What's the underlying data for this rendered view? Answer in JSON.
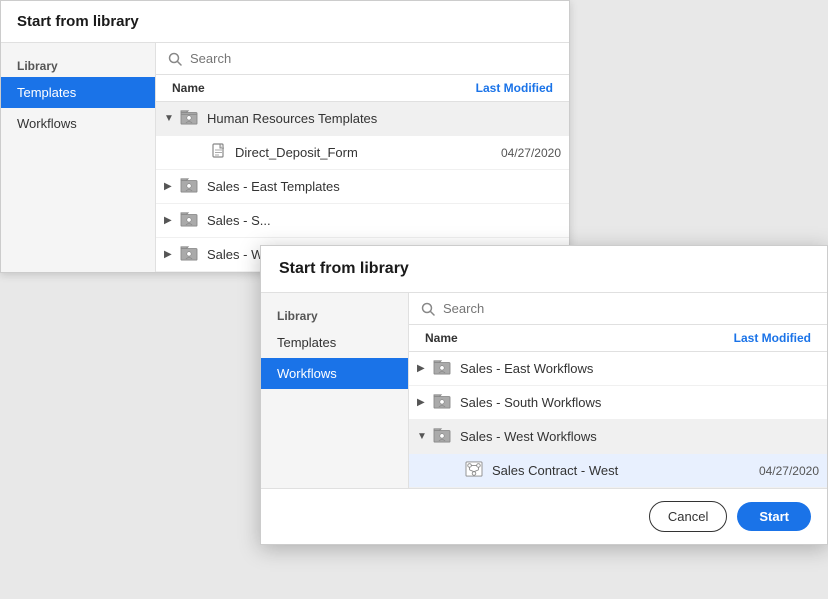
{
  "bg_dialog": {
    "title": "Start from library",
    "search_placeholder": "Search",
    "sidebar": {
      "section_label": "Library",
      "items": [
        {
          "id": "templates",
          "label": "Templates",
          "active": true
        },
        {
          "id": "workflows",
          "label": "Workflows",
          "active": false
        }
      ]
    },
    "table_headers": {
      "name": "Name",
      "last_modified": "Last Modified"
    },
    "rows": [
      {
        "type": "folder-group",
        "expanded": true,
        "indent": 0,
        "name": "Human Resources Templates",
        "children": [
          {
            "type": "doc",
            "indent": 1,
            "name": "Direct_Deposit_Form",
            "date": "04/27/2020"
          }
        ]
      },
      {
        "type": "folder-group",
        "expanded": false,
        "indent": 0,
        "name": "Sales - East Templates"
      },
      {
        "type": "folder-group",
        "expanded": false,
        "indent": 0,
        "name": "Sales - S..."
      },
      {
        "type": "folder-group",
        "expanded": false,
        "indent": 0,
        "name": "Sales - W..."
      }
    ]
  },
  "fg_dialog": {
    "title": "Start from library",
    "search_placeholder": "Search",
    "sidebar": {
      "section_label": "Library",
      "items": [
        {
          "id": "templates",
          "label": "Templates",
          "active": false
        },
        {
          "id": "workflows",
          "label": "Workflows",
          "active": true
        }
      ]
    },
    "table_headers": {
      "name": "Name",
      "last_modified": "Last Modified"
    },
    "rows": [
      {
        "type": "folder-group",
        "expanded": false,
        "name": "Sales - East Workflows"
      },
      {
        "type": "folder-group",
        "expanded": false,
        "name": "Sales - South Workflows"
      },
      {
        "type": "folder-group",
        "expanded": true,
        "name": "Sales - West Workflows",
        "children": [
          {
            "type": "workflow",
            "name": "Sales Contract - West",
            "date": "04/27/2020",
            "selected": true
          }
        ]
      }
    ],
    "footer": {
      "cancel_label": "Cancel",
      "start_label": "Start"
    }
  }
}
